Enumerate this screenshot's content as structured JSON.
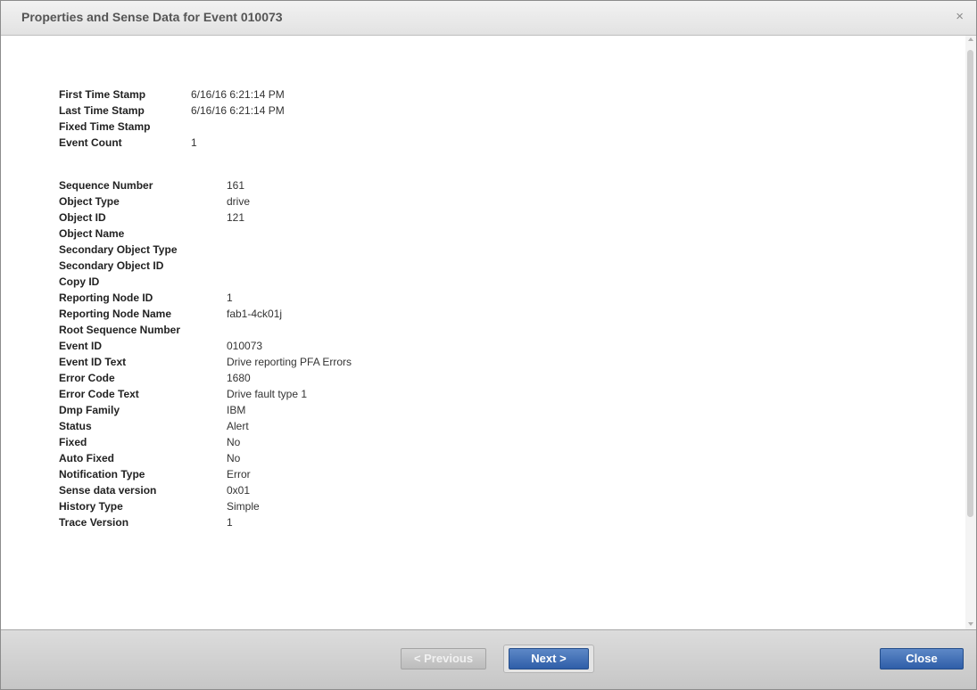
{
  "dialog": {
    "title": "Properties and Sense Data for Event 010073",
    "close_icon": "×"
  },
  "timestamps": [
    {
      "label": "First Time Stamp",
      "value": "6/16/16 6:21:14 PM"
    },
    {
      "label": "Last Time Stamp",
      "value": "6/16/16 6:21:14 PM"
    },
    {
      "label": "Fixed Time Stamp",
      "value": ""
    },
    {
      "label": "Event Count",
      "value": "1"
    }
  ],
  "properties": [
    {
      "label": "Sequence Number",
      "value": "161"
    },
    {
      "label": "Object Type",
      "value": "drive"
    },
    {
      "label": "Object ID",
      "value": "121"
    },
    {
      "label": "Object Name",
      "value": ""
    },
    {
      "label": "Secondary Object Type",
      "value": ""
    },
    {
      "label": "Secondary Object ID",
      "value": ""
    },
    {
      "label": "Copy ID",
      "value": ""
    },
    {
      "label": "Reporting Node ID",
      "value": "1"
    },
    {
      "label": "Reporting Node Name",
      "value": "fab1-4ck01j"
    },
    {
      "label": "Root Sequence Number",
      "value": ""
    },
    {
      "label": "Event ID",
      "value": "010073"
    },
    {
      "label": "Event ID Text",
      "value": "Drive reporting PFA Errors"
    },
    {
      "label": "Error Code",
      "value": "1680"
    },
    {
      "label": "Error Code Text",
      "value": "Drive fault type 1"
    },
    {
      "label": "Dmp Family",
      "value": "IBM"
    },
    {
      "label": "Status",
      "value": "Alert"
    },
    {
      "label": "Fixed",
      "value": "No"
    },
    {
      "label": "Auto Fixed",
      "value": "No"
    },
    {
      "label": "Notification Type",
      "value": "Error"
    },
    {
      "label": "Sense data version",
      "value": "0x01"
    },
    {
      "label": "History Type",
      "value": "Simple"
    },
    {
      "label": "Trace Version",
      "value": "1"
    }
  ],
  "footer": {
    "previous_label": "< Previous",
    "next_label": "Next >",
    "close_label": "Close"
  }
}
